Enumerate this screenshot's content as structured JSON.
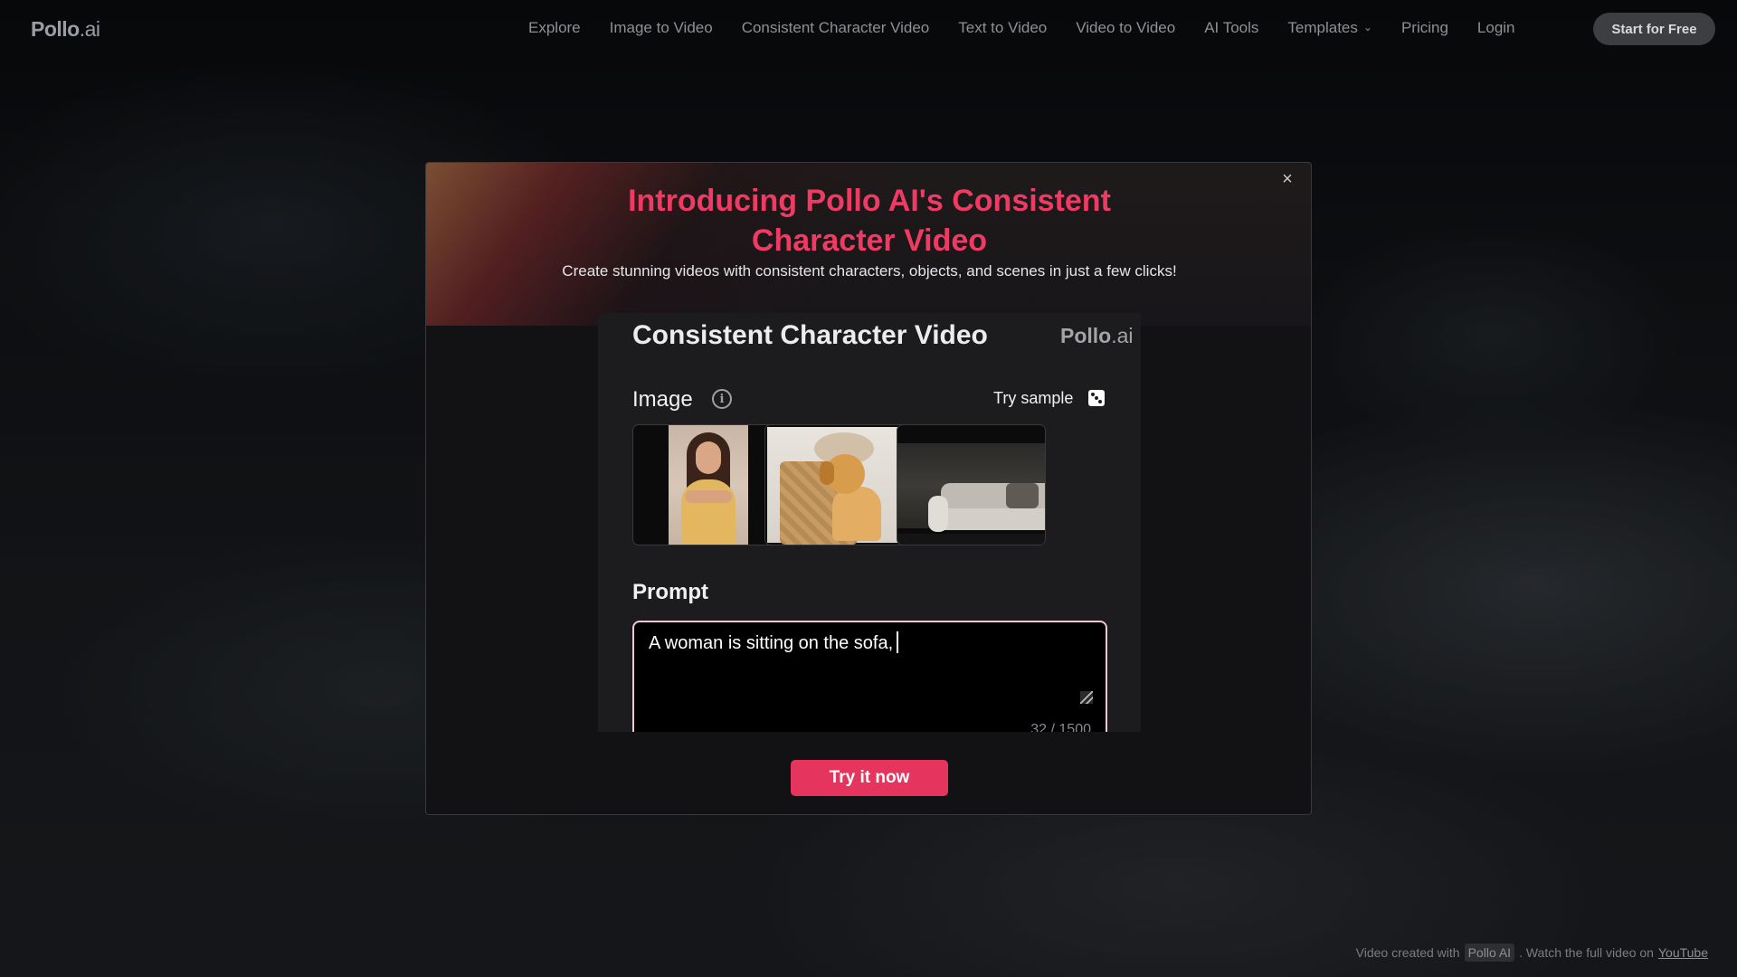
{
  "nav": {
    "logo_main": "Pollo",
    "logo_suffix": ".ai",
    "links": [
      "Explore",
      "Image to Video",
      "Consistent Character Video",
      "Text to Video",
      "Video to Video",
      "AI Tools",
      "Templates",
      "Pricing",
      "Login"
    ],
    "templates_icon": "chevron-down-icon",
    "cta": "Start for Free"
  },
  "modal": {
    "title_line1": "Introducing Pollo AI's Consistent",
    "title_line2": "Character Video",
    "subtitle": "Create stunning videos with consistent characters, objects, and scenes in just a few clicks!",
    "close_icon": "×",
    "card": {
      "title": "Consistent Character Video",
      "logo_main": "Pollo",
      "logo_suffix": ".ai",
      "image_label": "Image",
      "info_icon": "i",
      "try_sample": "Try sample",
      "images": [
        "woman-portrait",
        "golden-retriever-in-basket",
        "sofa-interior"
      ],
      "prompt_label": "Prompt",
      "prompt_value": "A woman is sitting on the sofa,",
      "counter": "32 / 1500"
    },
    "button": "Try it now"
  },
  "footer": {
    "prefix": "Video created with",
    "tag": "Pollo AI",
    "middle": ". Watch the full video on",
    "link": "YouTube"
  },
  "colors": {
    "accent": "#e5355e",
    "title": "#ef3b63"
  }
}
